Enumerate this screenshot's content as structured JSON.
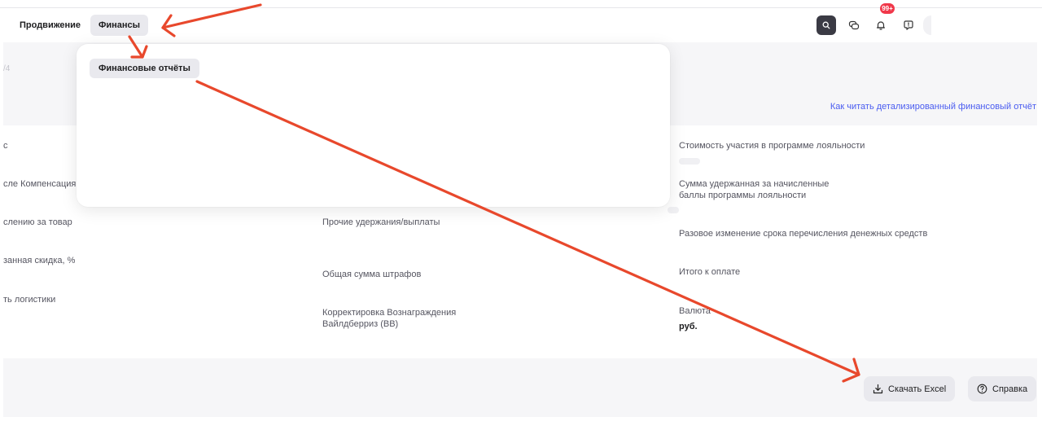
{
  "topbar": {
    "nav": [
      {
        "label": "Продвижение"
      },
      {
        "label": "Финансы",
        "active": true
      }
    ],
    "icons": [
      "search-icon",
      "chat-icon",
      "bell-icon",
      "support-icon"
    ],
    "notification_badge": "99+"
  },
  "dropdown": {
    "items": [
      {
        "label": "Финансовые отчёты"
      }
    ]
  },
  "page": {
    "faded_date": "/4",
    "help_link": "Как читать детализированный финансовый отчёт"
  },
  "fields": {
    "col1": [
      {
        "label": "с"
      },
      {
        "label": "сле Компенсация"
      },
      {
        "label": "слению за товар"
      },
      {
        "label": "занная скидка, %"
      },
      {
        "label": "ть логистики"
      }
    ],
    "col2": [
      {
        "label": "Прочие удержания/выплаты"
      },
      {
        "label": "Общая сумма штрафов"
      },
      {
        "label": "Корректировка Вознаграждения\nВайлдберриз (ВВ)"
      }
    ],
    "col3": [
      {
        "label": "Стоимость участия в программе лояльности"
      },
      {
        "label": "Сумма удержанная за начисленные\nбаллы программы лояльности"
      },
      {
        "label": "Разовое изменение срока перечисления денежных средств"
      },
      {
        "label": "Итого к оплате"
      },
      {
        "label": "Валюта",
        "value": "руб."
      }
    ]
  },
  "buttons": {
    "excel": "Скачать Excel",
    "help": "Справка"
  },
  "annotation": {
    "arrow_color": "#e8482c"
  }
}
